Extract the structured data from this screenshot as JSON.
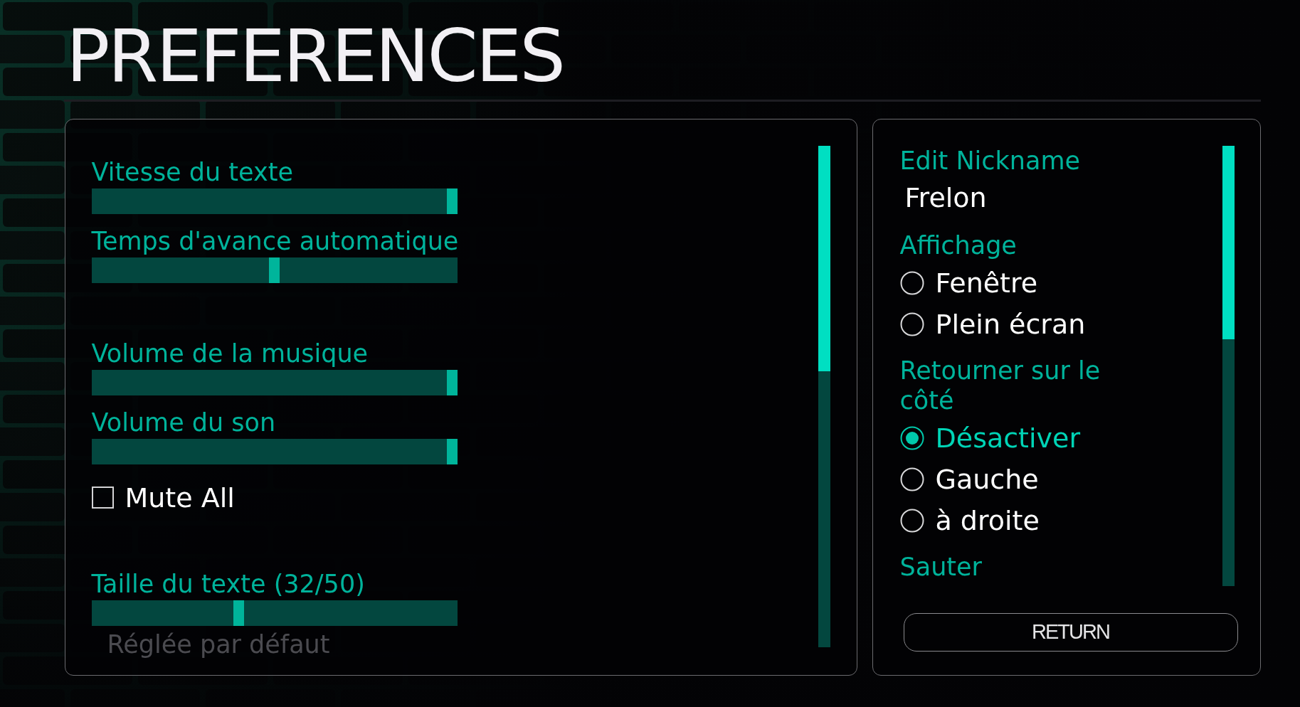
{
  "title": "PREFERENCES",
  "settings_panel": {
    "groups": [
      {
        "items": [
          {
            "kind": "slider",
            "label": "Vitesse du texte",
            "level": 1.0
          },
          {
            "kind": "slider",
            "label": "Temps d'avance automatique",
            "level": 0.5
          }
        ]
      },
      {
        "items": [
          {
            "kind": "slider",
            "label": "Volume de la musique",
            "level": 1.0
          },
          {
            "kind": "slider",
            "label": "Volume du son",
            "level": 1.0
          },
          {
            "kind": "checkbox",
            "label": "Mute All",
            "checked": false
          }
        ]
      },
      {
        "items": [
          {
            "kind": "slider",
            "label": "Taille du texte (32/50)",
            "level": 0.4
          },
          {
            "kind": "link",
            "label": "Réglée par défaut",
            "disabled": true
          }
        ]
      }
    ]
  },
  "side_panel": {
    "nickname": {
      "label": "Edit Nickname",
      "value": "Frelon"
    },
    "groups": [
      {
        "label": "Affichage",
        "options": [
          {
            "label": "Fenêtre",
            "selected": false
          },
          {
            "label": "Plein écran",
            "selected": false
          }
        ]
      },
      {
        "label": "Retourner sur le côté",
        "options": [
          {
            "label": "Désactiver",
            "selected": true
          },
          {
            "label": "Gauche",
            "selected": false
          },
          {
            "label": "à droite",
            "selected": false
          }
        ]
      },
      {
        "label": "Sauter"
      }
    ],
    "return_button": "RETURN"
  }
}
